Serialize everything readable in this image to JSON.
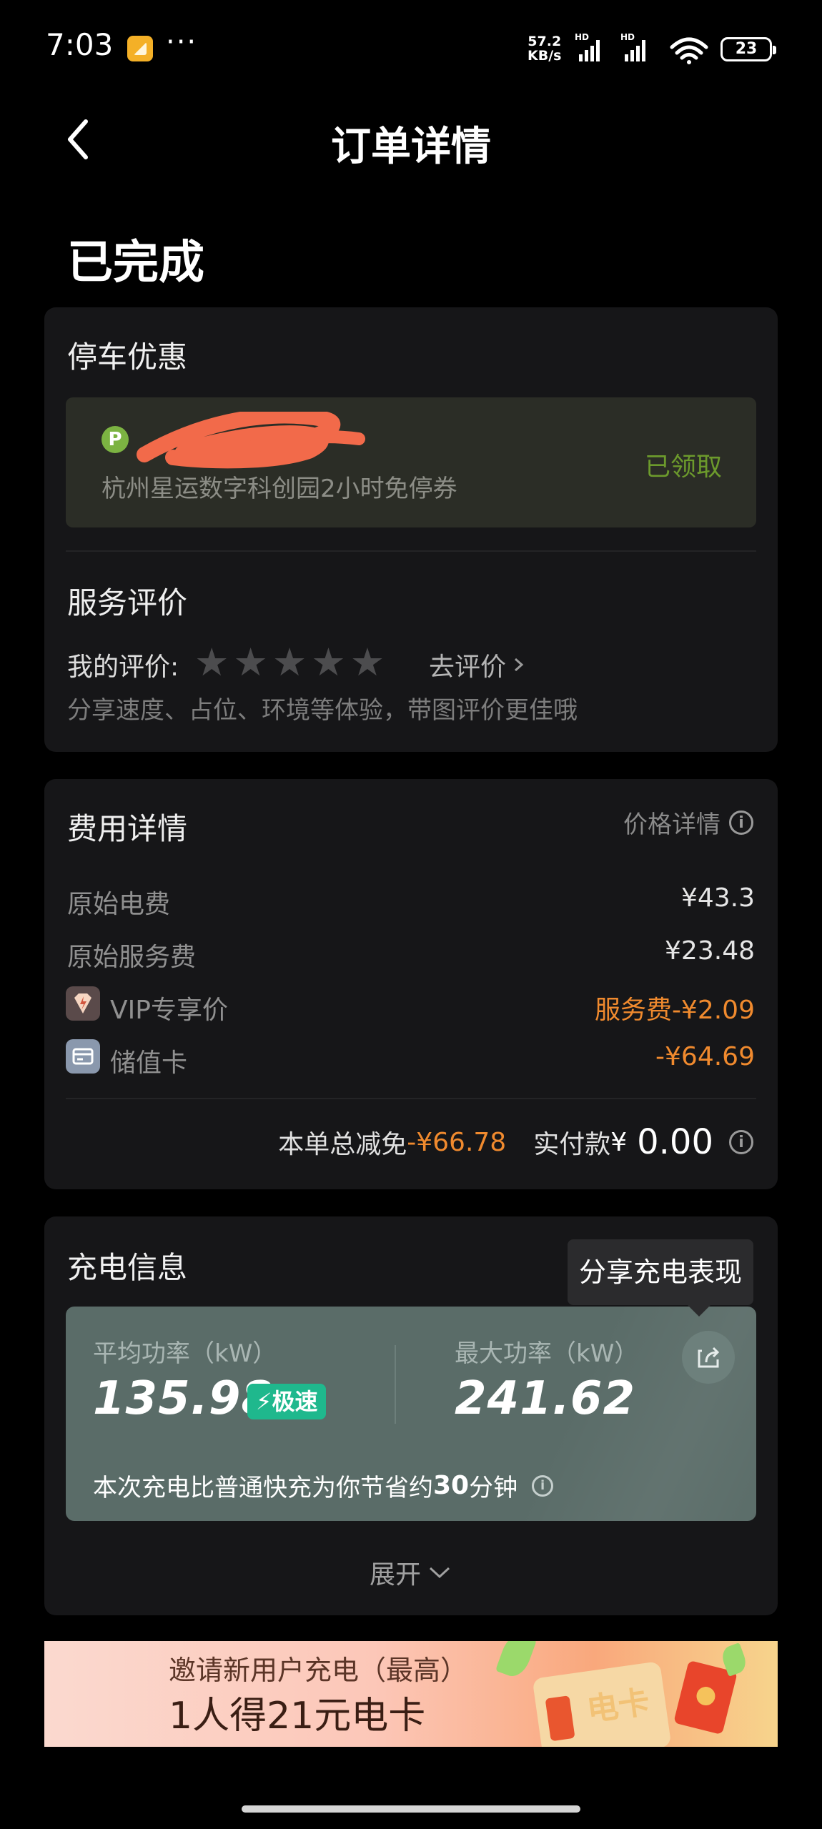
{
  "status_bar": {
    "time": "7:03",
    "more": "···",
    "net_speed_value": "57.2",
    "net_speed_unit": "KB/s",
    "battery": "23"
  },
  "header": {
    "title": "订单详情"
  },
  "order_status": "已完成",
  "parking": {
    "title": "停车优惠",
    "badge": "P",
    "description": "杭州星运数字科创园2小时免停券",
    "status": "已领取"
  },
  "rating": {
    "title": "服务评价",
    "label": "我的评价:",
    "stars": 5,
    "link": "去评价",
    "hint": "分享速度、占位、环境等体验，带图评价更佳哦"
  },
  "fees": {
    "title": "费用详情",
    "price_detail_link": "价格详情",
    "rows": [
      {
        "label": "原始电费",
        "value": "¥43.3"
      },
      {
        "label": "原始服务费",
        "value": "¥23.48"
      },
      {
        "label": "VIP专享价",
        "value": "服务费-¥2.09"
      },
      {
        "label": "储值卡",
        "value": "-¥64.69"
      }
    ],
    "total_discount_label": "本单总减免",
    "total_discount_value": "-¥66.78",
    "paid_label": "实付款",
    "paid_currency": "¥",
    "paid_value": "0.00"
  },
  "charging": {
    "title": "充电信息",
    "share_tooltip": "分享充电表现",
    "avg_power_label": "平均功率（kW）",
    "avg_power_value": "135.98",
    "speed_badge": "极速",
    "max_power_label": "最大功率（kW）",
    "max_power_value": "241.62",
    "saving_prefix": "本次充电比普通快充为你节省约",
    "saving_minutes": "30",
    "saving_suffix": "分钟",
    "expand_label": "展开"
  },
  "banner": {
    "line1": "邀请新用户充电（最高）",
    "line2": "1人得21元电卡",
    "card_text": "电卡"
  },
  "colors": {
    "background": "#000000",
    "card": "#161618",
    "accent_orange": "#f08a2e",
    "claimed_green": "#6c9a2c",
    "speed_badge": "#1fb88d"
  }
}
